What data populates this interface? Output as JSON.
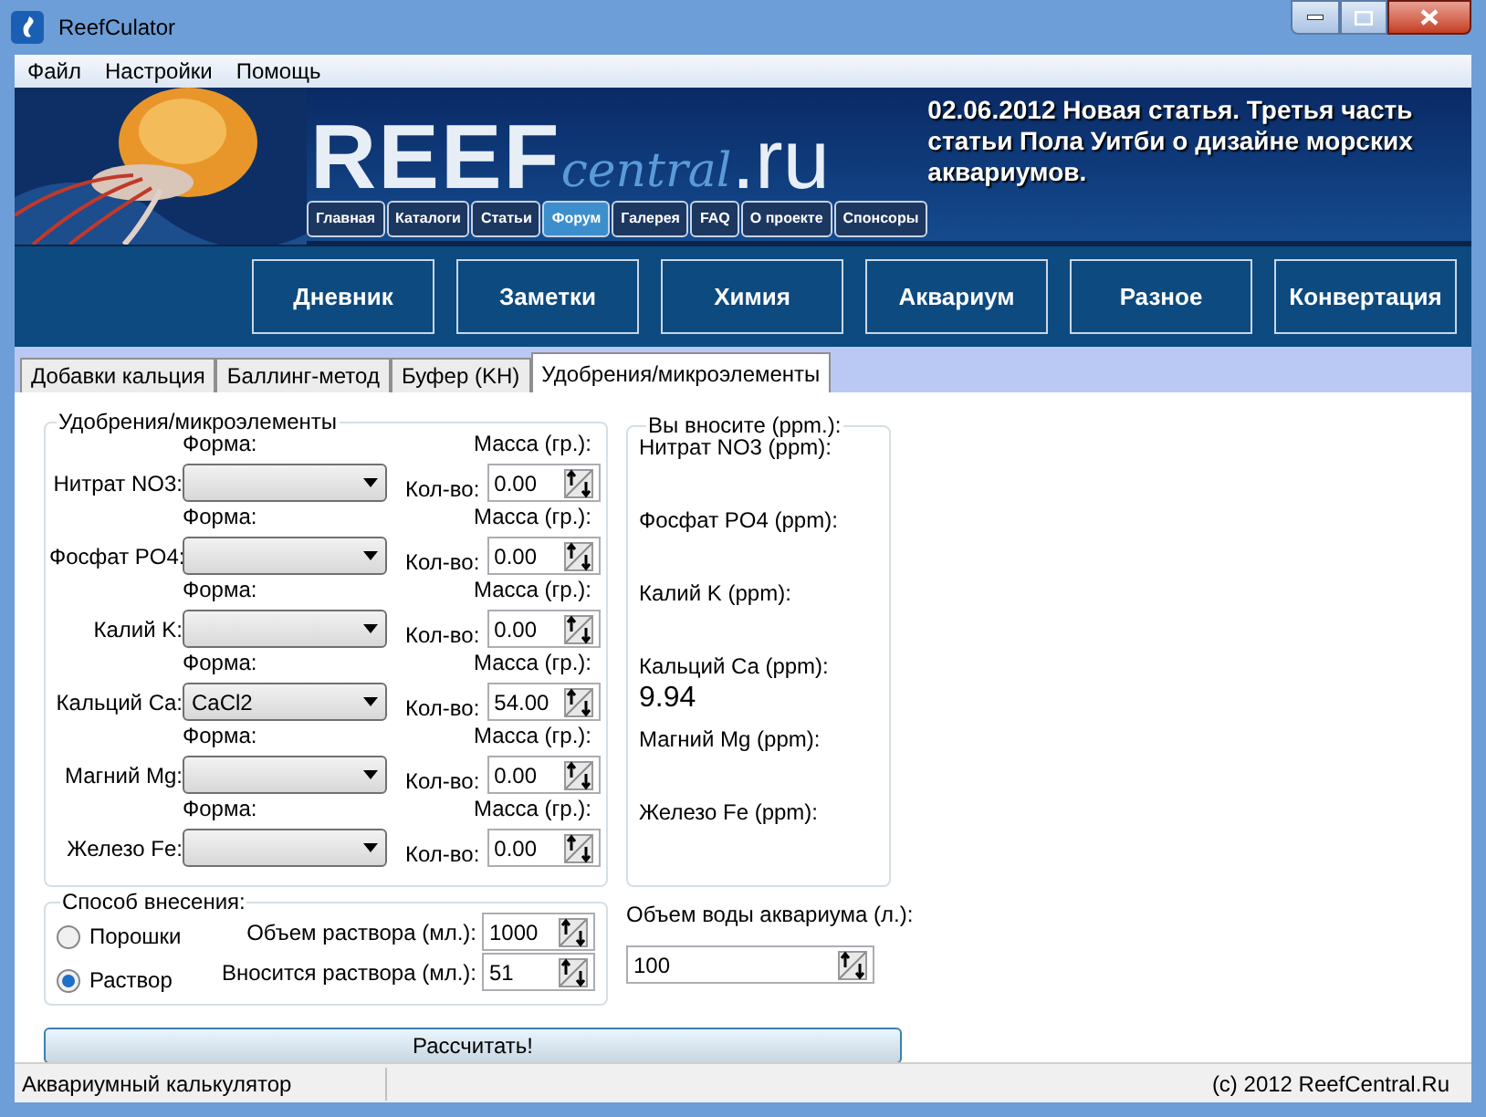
{
  "window": {
    "title": "ReefCulator"
  },
  "menu": [
    "Файл",
    "Настройки",
    "Помощь"
  ],
  "banner": {
    "logo": {
      "main": "REEF",
      "script": "central",
      "suffix": ".ru"
    },
    "links": [
      {
        "label": "Главная",
        "selected": false
      },
      {
        "label": "Каталоги",
        "selected": false
      },
      {
        "label": "Статьи",
        "selected": false
      },
      {
        "label": "Форум",
        "selected": true
      },
      {
        "label": "Галерея",
        "selected": false
      },
      {
        "label": "FAQ",
        "selected": false
      },
      {
        "label": "О проекте",
        "selected": false
      },
      {
        "label": "Спонсоры",
        "selected": false
      }
    ],
    "news": "02.06.2012 Новая статья. Третья часть статьи Пола Уитби о дизайне морских аквариумов."
  },
  "nav": [
    "Дневник",
    "Заметки",
    "Химия",
    "Аквариум",
    "Разное",
    "Конвертация"
  ],
  "tabs": [
    {
      "label": "Добавки кальция",
      "selected": false
    },
    {
      "label": "Баллинг-метод",
      "selected": false
    },
    {
      "label": "Буфер (KH)",
      "selected": false
    },
    {
      "label": "Удобрения/микроэлементы",
      "selected": true
    }
  ],
  "fertilizers": {
    "title": "Удобрения/микроэлементы",
    "rows": [
      {
        "label": "Нитрат NO3:",
        "form_label": "Форма:",
        "form_value": "",
        "mass_label": "Масса (гр.):",
        "qty_label": "Кол-во:",
        "qty": "0.00"
      },
      {
        "label": "Фосфат PO4:",
        "form_label": "Форма:",
        "form_value": "",
        "mass_label": "Масса (гр.):",
        "qty_label": "Кол-во:",
        "qty": "0.00"
      },
      {
        "label": "Калий K:",
        "form_label": "Форма:",
        "form_value": "",
        "mass_label": "Масса (гр.):",
        "qty_label": "Кол-во:",
        "qty": "0.00"
      },
      {
        "label": "Кальций Ca:",
        "form_label": "Форма:",
        "form_value": "CaCl2",
        "mass_label": "Масса (гр.):",
        "qty_label": "Кол-во:",
        "qty": "54.00"
      },
      {
        "label": "Магний Mg:",
        "form_label": "Форма:",
        "form_value": "",
        "mass_label": "Масса (гр.):",
        "qty_label": "Кол-во:",
        "qty": "0.00"
      },
      {
        "label": "Железо Fe:",
        "form_label": "Форма:",
        "form_value": "",
        "mass_label": "Масса (гр.):",
        "qty_label": "Кол-во:",
        "qty": "0.00"
      }
    ]
  },
  "results": {
    "title": "Вы вносите (ppm.):",
    "items": [
      {
        "label": "Нитрат NO3 (ppm):"
      },
      {
        "label": "Фосфат PO4 (ppm):"
      },
      {
        "label": "Калий K (ppm):"
      },
      {
        "label": "Кальций Ca (ppm):",
        "value": "9.94"
      },
      {
        "label": "Магний Mg (ppm):"
      },
      {
        "label": "Железо Fe (ppm):"
      }
    ]
  },
  "method": {
    "title": "Способ внесения:",
    "options": [
      {
        "label": "Порошки",
        "selected": false
      },
      {
        "label": "Раствор",
        "selected": true
      }
    ],
    "fields": [
      {
        "label": "Объем раствора (мл.):",
        "value": "1000"
      },
      {
        "label": "Вносится раствора (мл.):",
        "value": "51"
      }
    ]
  },
  "volume": {
    "label": "Объем воды аквариума (л.):",
    "value": "100"
  },
  "calculate_button": "Рассчитать!",
  "status_bar": {
    "left": "Аквариумный калькулятор",
    "right": "(c) 2012 ReefCentral.Ru"
  }
}
